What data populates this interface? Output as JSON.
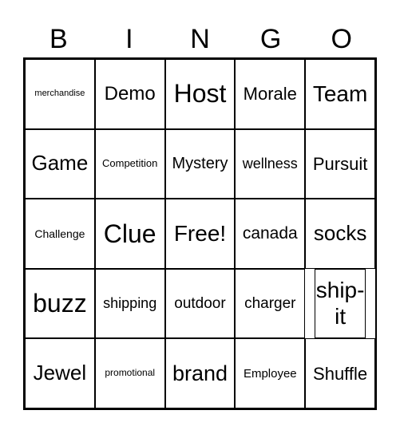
{
  "header": [
    "B",
    "I",
    "N",
    "G",
    "O"
  ],
  "cells": [
    {
      "text": "merchandise",
      "size": 11
    },
    {
      "text": "Demo",
      "size": 24
    },
    {
      "text": "Host",
      "size": 32
    },
    {
      "text": "Morale",
      "size": 22
    },
    {
      "text": "Team",
      "size": 28
    },
    {
      "text": "Game",
      "size": 26
    },
    {
      "text": "Competition",
      "size": 13
    },
    {
      "text": "Mystery",
      "size": 20
    },
    {
      "text": "wellness",
      "size": 18
    },
    {
      "text": "Pursuit",
      "size": 22
    },
    {
      "text": "Challenge",
      "size": 14
    },
    {
      "text": "Clue",
      "size": 32
    },
    {
      "text": "Free!",
      "size": 28
    },
    {
      "text": "canada",
      "size": 21
    },
    {
      "text": "socks",
      "size": 26
    },
    {
      "text": "buzz",
      "size": 32
    },
    {
      "text": "shipping",
      "size": 18
    },
    {
      "text": "outdoor",
      "size": 19
    },
    {
      "text": "charger",
      "size": 19
    },
    {
      "text": "ship-it",
      "size": 28
    },
    {
      "text": "Jewel",
      "size": 26
    },
    {
      "text": "promotional",
      "size": 12
    },
    {
      "text": "brand",
      "size": 27
    },
    {
      "text": "Employee",
      "size": 15
    },
    {
      "text": "Shuffle",
      "size": 22
    }
  ]
}
